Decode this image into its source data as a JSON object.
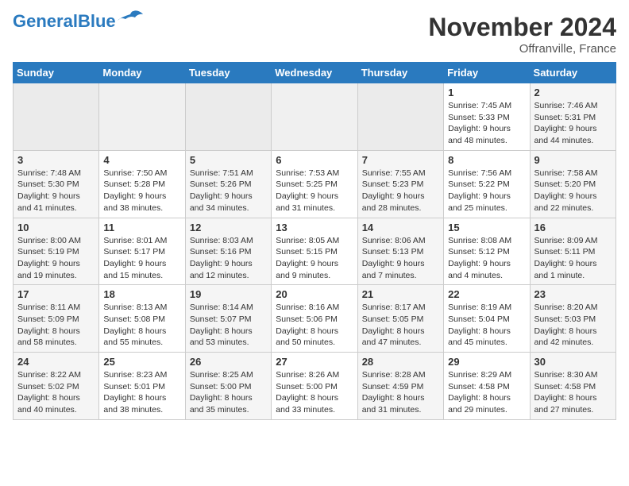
{
  "header": {
    "logo_general": "General",
    "logo_blue": "Blue",
    "month": "November 2024",
    "location": "Offranville, France"
  },
  "weekdays": [
    "Sunday",
    "Monday",
    "Tuesday",
    "Wednesday",
    "Thursday",
    "Friday",
    "Saturday"
  ],
  "weeks": [
    [
      {
        "day": "",
        "info": ""
      },
      {
        "day": "",
        "info": ""
      },
      {
        "day": "",
        "info": ""
      },
      {
        "day": "",
        "info": ""
      },
      {
        "day": "",
        "info": ""
      },
      {
        "day": "1",
        "info": "Sunrise: 7:45 AM\nSunset: 5:33 PM\nDaylight: 9 hours\nand 48 minutes."
      },
      {
        "day": "2",
        "info": "Sunrise: 7:46 AM\nSunset: 5:31 PM\nDaylight: 9 hours\nand 44 minutes."
      }
    ],
    [
      {
        "day": "3",
        "info": "Sunrise: 7:48 AM\nSunset: 5:30 PM\nDaylight: 9 hours\nand 41 minutes."
      },
      {
        "day": "4",
        "info": "Sunrise: 7:50 AM\nSunset: 5:28 PM\nDaylight: 9 hours\nand 38 minutes."
      },
      {
        "day": "5",
        "info": "Sunrise: 7:51 AM\nSunset: 5:26 PM\nDaylight: 9 hours\nand 34 minutes."
      },
      {
        "day": "6",
        "info": "Sunrise: 7:53 AM\nSunset: 5:25 PM\nDaylight: 9 hours\nand 31 minutes."
      },
      {
        "day": "7",
        "info": "Sunrise: 7:55 AM\nSunset: 5:23 PM\nDaylight: 9 hours\nand 28 minutes."
      },
      {
        "day": "8",
        "info": "Sunrise: 7:56 AM\nSunset: 5:22 PM\nDaylight: 9 hours\nand 25 minutes."
      },
      {
        "day": "9",
        "info": "Sunrise: 7:58 AM\nSunset: 5:20 PM\nDaylight: 9 hours\nand 22 minutes."
      }
    ],
    [
      {
        "day": "10",
        "info": "Sunrise: 8:00 AM\nSunset: 5:19 PM\nDaylight: 9 hours\nand 19 minutes."
      },
      {
        "day": "11",
        "info": "Sunrise: 8:01 AM\nSunset: 5:17 PM\nDaylight: 9 hours\nand 15 minutes."
      },
      {
        "day": "12",
        "info": "Sunrise: 8:03 AM\nSunset: 5:16 PM\nDaylight: 9 hours\nand 12 minutes."
      },
      {
        "day": "13",
        "info": "Sunrise: 8:05 AM\nSunset: 5:15 PM\nDaylight: 9 hours\nand 9 minutes."
      },
      {
        "day": "14",
        "info": "Sunrise: 8:06 AM\nSunset: 5:13 PM\nDaylight: 9 hours\nand 7 minutes."
      },
      {
        "day": "15",
        "info": "Sunrise: 8:08 AM\nSunset: 5:12 PM\nDaylight: 9 hours\nand 4 minutes."
      },
      {
        "day": "16",
        "info": "Sunrise: 8:09 AM\nSunset: 5:11 PM\nDaylight: 9 hours\nand 1 minute."
      }
    ],
    [
      {
        "day": "17",
        "info": "Sunrise: 8:11 AM\nSunset: 5:09 PM\nDaylight: 8 hours\nand 58 minutes."
      },
      {
        "day": "18",
        "info": "Sunrise: 8:13 AM\nSunset: 5:08 PM\nDaylight: 8 hours\nand 55 minutes."
      },
      {
        "day": "19",
        "info": "Sunrise: 8:14 AM\nSunset: 5:07 PM\nDaylight: 8 hours\nand 53 minutes."
      },
      {
        "day": "20",
        "info": "Sunrise: 8:16 AM\nSunset: 5:06 PM\nDaylight: 8 hours\nand 50 minutes."
      },
      {
        "day": "21",
        "info": "Sunrise: 8:17 AM\nSunset: 5:05 PM\nDaylight: 8 hours\nand 47 minutes."
      },
      {
        "day": "22",
        "info": "Sunrise: 8:19 AM\nSunset: 5:04 PM\nDaylight: 8 hours\nand 45 minutes."
      },
      {
        "day": "23",
        "info": "Sunrise: 8:20 AM\nSunset: 5:03 PM\nDaylight: 8 hours\nand 42 minutes."
      }
    ],
    [
      {
        "day": "24",
        "info": "Sunrise: 8:22 AM\nSunset: 5:02 PM\nDaylight: 8 hours\nand 40 minutes."
      },
      {
        "day": "25",
        "info": "Sunrise: 8:23 AM\nSunset: 5:01 PM\nDaylight: 8 hours\nand 38 minutes."
      },
      {
        "day": "26",
        "info": "Sunrise: 8:25 AM\nSunset: 5:00 PM\nDaylight: 8 hours\nand 35 minutes."
      },
      {
        "day": "27",
        "info": "Sunrise: 8:26 AM\nSunset: 5:00 PM\nDaylight: 8 hours\nand 33 minutes."
      },
      {
        "day": "28",
        "info": "Sunrise: 8:28 AM\nSunset: 4:59 PM\nDaylight: 8 hours\nand 31 minutes."
      },
      {
        "day": "29",
        "info": "Sunrise: 8:29 AM\nSunset: 4:58 PM\nDaylight: 8 hours\nand 29 minutes."
      },
      {
        "day": "30",
        "info": "Sunrise: 8:30 AM\nSunset: 4:58 PM\nDaylight: 8 hours\nand 27 minutes."
      }
    ]
  ]
}
